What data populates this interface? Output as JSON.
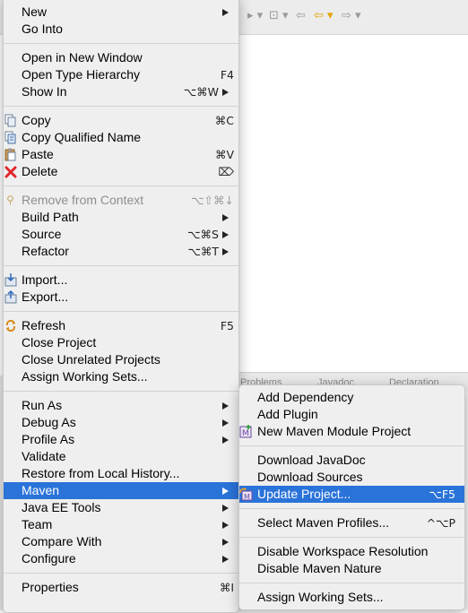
{
  "toolbar": {
    "glyphs": [
      "▸ ▾",
      "⊡ ▾",
      "⇦",
      "⇦ ▾",
      "⇨ ▾"
    ]
  },
  "lower_tabs": [
    "Problems",
    "Javadoc",
    "Declaration"
  ],
  "main_menu": {
    "new": {
      "label": "New"
    },
    "go_into": {
      "label": "Go Into"
    },
    "open_new_window": {
      "label": "Open in New Window"
    },
    "open_type_hierarchy": {
      "label": "Open Type Hierarchy",
      "shortcut": "F4"
    },
    "show_in": {
      "label": "Show In",
      "shortcut": "⌥⌘W"
    },
    "copy": {
      "label": "Copy",
      "shortcut": "⌘C"
    },
    "copy_qualified": {
      "label": "Copy Qualified Name"
    },
    "paste": {
      "label": "Paste",
      "shortcut": "⌘V"
    },
    "delete": {
      "label": "Delete",
      "shortcut": "⌦"
    },
    "remove_context": {
      "label": "Remove from Context",
      "shortcut": "⌥⇧⌘↓"
    },
    "build_path": {
      "label": "Build Path"
    },
    "source": {
      "label": "Source",
      "shortcut": "⌥⌘S"
    },
    "refactor": {
      "label": "Refactor",
      "shortcut": "⌥⌘T"
    },
    "import": {
      "label": "Import..."
    },
    "export": {
      "label": "Export..."
    },
    "refresh": {
      "label": "Refresh",
      "shortcut": "F5"
    },
    "close_project": {
      "label": "Close Project"
    },
    "close_unrelated": {
      "label": "Close Unrelated Projects"
    },
    "assign_working_sets": {
      "label": "Assign Working Sets..."
    },
    "run_as": {
      "label": "Run As"
    },
    "debug_as": {
      "label": "Debug As"
    },
    "profile_as": {
      "label": "Profile As"
    },
    "validate": {
      "label": "Validate"
    },
    "restore_history": {
      "label": "Restore from Local History..."
    },
    "maven": {
      "label": "Maven"
    },
    "java_ee_tools": {
      "label": "Java EE Tools"
    },
    "team": {
      "label": "Team"
    },
    "compare_with": {
      "label": "Compare With"
    },
    "configure": {
      "label": "Configure"
    },
    "properties": {
      "label": "Properties",
      "shortcut": "⌘I"
    }
  },
  "maven_menu": {
    "add_dependency": {
      "label": "Add Dependency"
    },
    "add_plugin": {
      "label": "Add Plugin"
    },
    "new_module": {
      "label": "New Maven Module Project"
    },
    "download_javadoc": {
      "label": "Download JavaDoc"
    },
    "download_sources": {
      "label": "Download Sources"
    },
    "update_project": {
      "label": "Update Project...",
      "shortcut": "⌥F5"
    },
    "select_profiles": {
      "label": "Select Maven Profiles...",
      "shortcut": "^⌥P"
    },
    "disable_workspace": {
      "label": "Disable Workspace Resolution"
    },
    "disable_nature": {
      "label": "Disable Maven Nature"
    },
    "assign_working_sets": {
      "label": "Assign Working Sets..."
    }
  },
  "colors": {
    "highlight": "#2a73d9",
    "menu_bg": "#efefef",
    "disabled_text": "#8e8e8e",
    "delete_icon": "#e0262a"
  },
  "icons": {
    "copy": "copy-icon",
    "copy_qualified": "copy-qualified-icon",
    "paste": "paste-icon",
    "delete": "delete-icon",
    "remove_context": "remove-context-icon",
    "import": "import-icon",
    "export": "export-icon",
    "refresh": "refresh-icon",
    "new_module": "maven-module-icon",
    "update_project": "maven-update-icon"
  }
}
